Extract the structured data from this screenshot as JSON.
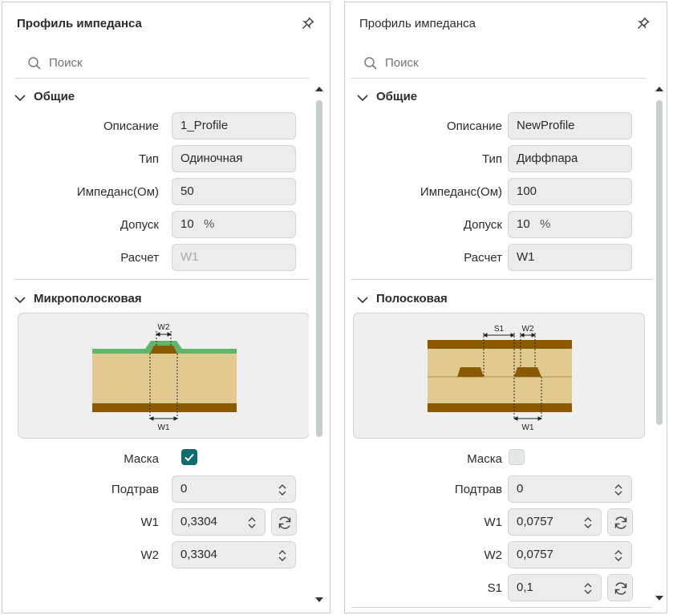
{
  "left": {
    "title": "Профиль импеданса",
    "search_placeholder": "Поиск",
    "general": {
      "header": "Общие",
      "description": {
        "label": "Описание",
        "value": "1_Profile"
      },
      "type": {
        "label": "Тип",
        "value": "Одиночная"
      },
      "impedance": {
        "label": "Импеданс(Ом)",
        "value": "50"
      },
      "tolerance": {
        "label": "Допуск",
        "value": "10",
        "unit": "%"
      },
      "calc": {
        "label": "Расчет",
        "value": "W1"
      }
    },
    "geometry": {
      "header": "Микрополосковая",
      "diagram": {
        "w1": "W1",
        "w2": "W2"
      },
      "mask": {
        "label": "Маска",
        "checked": true
      },
      "etch": {
        "label": "Подтрав",
        "value": "0"
      },
      "w1": {
        "label": "W1",
        "value": "0,3304"
      },
      "w2": {
        "label": "W2",
        "value": "0,3304"
      }
    }
  },
  "right": {
    "title": "Профиль импеданса",
    "search_placeholder": "Поиск",
    "general": {
      "header": "Общие",
      "description": {
        "label": "Описание",
        "value": "NewProfile"
      },
      "type": {
        "label": "Тип",
        "value": "Диффпара"
      },
      "impedance": {
        "label": "Импеданс(Ом)",
        "value": "100"
      },
      "tolerance": {
        "label": "Допуск",
        "value": "10",
        "unit": "%"
      },
      "calc": {
        "label": "Расчет",
        "value": "W1"
      }
    },
    "geometry": {
      "header": "Полосковая",
      "diagram": {
        "s1": "S1",
        "w1": "W1",
        "w2": "W2"
      },
      "mask": {
        "label": "Маска",
        "checked": false
      },
      "etch": {
        "label": "Подтрав",
        "value": "0"
      },
      "w1": {
        "label": "W1",
        "value": "0,0757"
      },
      "w2": {
        "label": "W2",
        "value": "0,0757"
      },
      "s1": {
        "label": "S1",
        "value": "0,1"
      }
    }
  },
  "colors": {
    "accent": "#0e6b6e",
    "dielectric": "#e2c990",
    "copper": "#8a5a00",
    "mask": "#5fb56a",
    "field_bg": "#ececec"
  }
}
